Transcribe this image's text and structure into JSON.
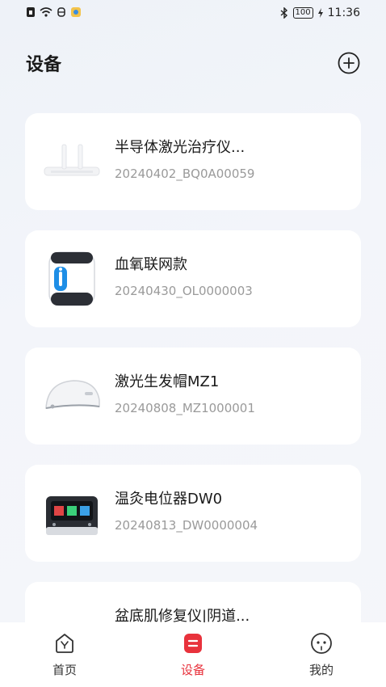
{
  "status_bar": {
    "time": "11:36",
    "battery": "100",
    "icons": [
      "sim-icon",
      "wifi-icon",
      "notification-icon",
      "app-icon",
      "bluetooth-icon",
      "battery-icon",
      "charging-icon"
    ]
  },
  "header": {
    "title": "设备",
    "add_icon": "plus-circle-icon"
  },
  "devices": [
    {
      "name": "半导体激光治疗仪...",
      "serial": "20240402_BQ0A00059",
      "image": "laser-therapy-device"
    },
    {
      "name": "血氧联网款",
      "serial": "20240430_OL0000003",
      "image": "oxygen-concentrator"
    },
    {
      "name": "激光生发帽MZ1",
      "serial": "20240808_MZ1000001",
      "image": "laser-helmet"
    },
    {
      "name": "温灸电位器DW0",
      "serial": "20240813_DW0000004",
      "image": "potential-therapy-device"
    },
    {
      "name": "盆底肌修复仪|阴道...",
      "serial": "",
      "image": "pelvic-repair-device"
    }
  ],
  "tabs": [
    {
      "label": "首页",
      "icon": "home-icon",
      "active": false
    },
    {
      "label": "设备",
      "icon": "device-icon",
      "active": true
    },
    {
      "label": "我的",
      "icon": "profile-icon",
      "active": false
    }
  ],
  "colors": {
    "accent": "#e8323c",
    "background": "#f3f5fa",
    "card": "#ffffff",
    "secondary_text": "#9a9a9a"
  }
}
